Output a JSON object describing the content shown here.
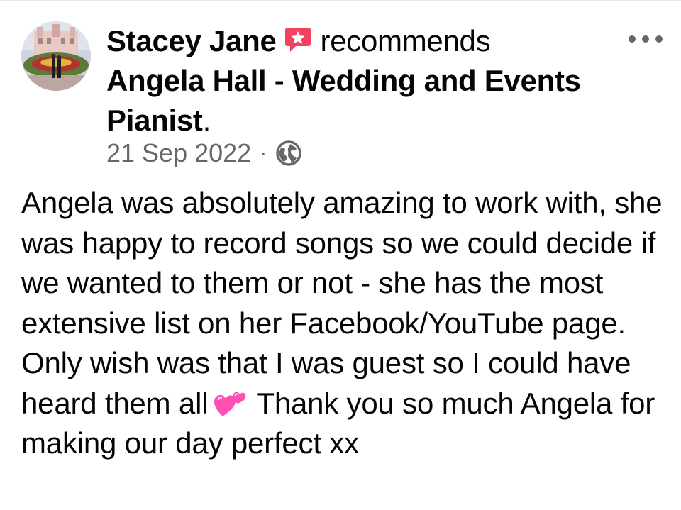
{
  "post": {
    "author": "Stacey Jane",
    "verb": "recommends",
    "page_name": "Angela Hall - Wedding and Events Pianist",
    "period": ".",
    "date": "21 Sep 2022",
    "separator": "·",
    "audience_icon": "globe-icon",
    "badge_icon": "recommendation-star-icon",
    "more_icon": "more-options-icon",
    "body_part1": "Angela was absolutely amazing to work with, she was happy to record songs so we could decide if we wanted to them or not - she has the most extensive list on her Facebook/YouTube page. Only wish was that I was guest so I could have heard them all",
    "emoji": "two-hearts-emoji",
    "body_part2": "Thank you so much Angela for making our day perfect xx"
  },
  "colors": {
    "text": "#050505",
    "secondary_text": "#65676b",
    "badge": "#f3425f",
    "emoji": "#ff4fb3"
  }
}
